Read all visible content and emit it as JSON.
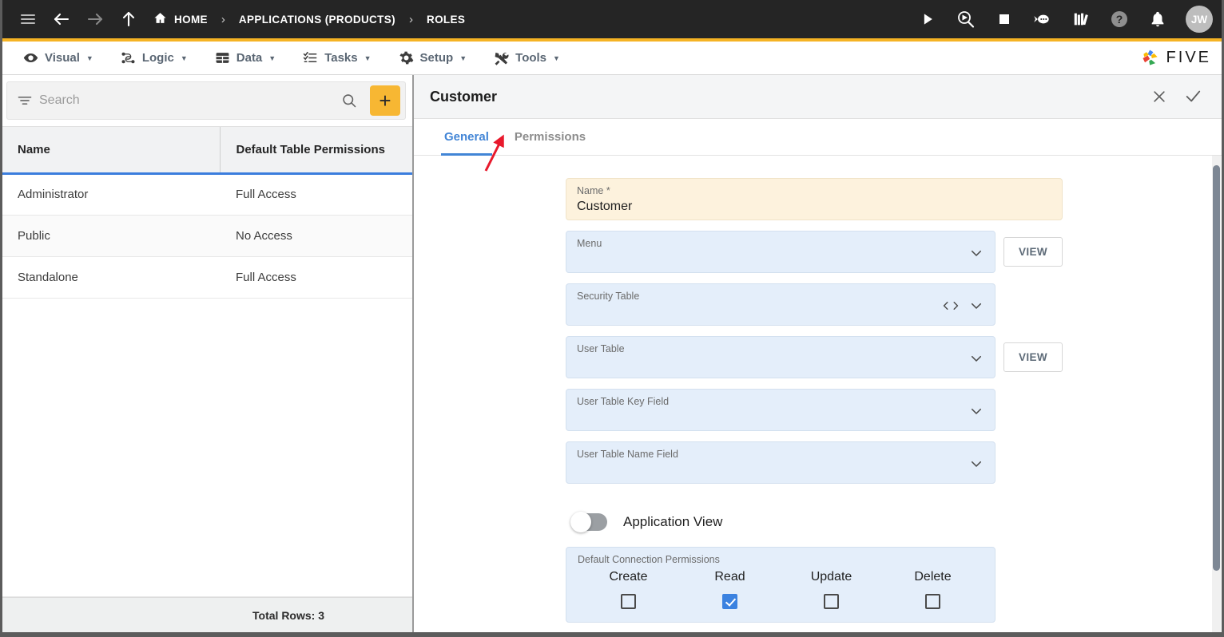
{
  "topbar": {
    "menu_icon": "hamburger-icon",
    "back_icon": "arrow-left-icon",
    "forward_icon": "arrow-right-icon",
    "up_icon": "arrow-up-icon",
    "breadcrumbs": [
      {
        "label": "HOME",
        "icon": "home-icon"
      },
      {
        "label": "APPLICATIONS (PRODUCTS)",
        "icon": ""
      },
      {
        "label": "ROLES",
        "icon": ""
      }
    ],
    "separator": "›",
    "actions": [
      {
        "name": "run-icon",
        "title": "Run"
      },
      {
        "name": "debug-icon",
        "title": "Debug"
      },
      {
        "name": "stop-icon",
        "title": "Stop"
      },
      {
        "name": "chat-bot-icon",
        "title": "Assistant"
      },
      {
        "name": "library-icon",
        "title": "Library"
      },
      {
        "name": "help-icon",
        "title": "Help"
      },
      {
        "name": "notifications-bell-icon",
        "title": "Notifications"
      }
    ],
    "avatar_initials": "JW"
  },
  "menubar": {
    "items": [
      {
        "label": "Visual",
        "icon": "eye-icon",
        "caret": "▼"
      },
      {
        "label": "Logic",
        "icon": "logic-nodes-icon",
        "caret": "▼"
      },
      {
        "label": "Data",
        "icon": "table-grid-icon",
        "caret": "▼"
      },
      {
        "label": "Tasks",
        "icon": "checklist-icon",
        "caret": "▼"
      },
      {
        "label": "Setup",
        "icon": "gear-icon",
        "caret": "▼"
      },
      {
        "label": "Tools",
        "icon": "tools-wrench-icon",
        "caret": "▼"
      }
    ],
    "brand": "FIVE"
  },
  "list_panel": {
    "search": {
      "placeholder": "Search",
      "value": "",
      "filter_icon": "filter-icon",
      "search_icon": "search-icon",
      "add_label": "+"
    },
    "columns": [
      "Name",
      "Default Table Permissions"
    ],
    "rows": [
      {
        "name": "Administrator",
        "permissions": "Full Access"
      },
      {
        "name": "Public",
        "permissions": "No Access"
      },
      {
        "name": "Standalone",
        "permissions": "Full Access"
      }
    ],
    "footer": "Total Rows: 3"
  },
  "detail_panel": {
    "title": "Customer",
    "close_icon": "close-icon",
    "confirm_icon": "check-icon",
    "tabs": [
      {
        "label": "General",
        "active": true
      },
      {
        "label": "Permissions",
        "active": false
      }
    ],
    "fields": [
      {
        "label": "Name *",
        "value": "Customer",
        "style": "name",
        "icons": [],
        "button": ""
      },
      {
        "label": "Menu",
        "value": "",
        "style": "normal",
        "icons": [
          "chevron-down-icon"
        ],
        "button": "VIEW"
      },
      {
        "label": "Security Table",
        "value": "",
        "style": "normal",
        "icons": [
          "code-brackets-icon",
          "chevron-down-icon"
        ],
        "button": ""
      },
      {
        "label": "User Table",
        "value": "",
        "style": "normal",
        "icons": [
          "chevron-down-icon"
        ],
        "button": "VIEW"
      },
      {
        "label": "User Table Key Field",
        "value": "",
        "style": "normal",
        "icons": [
          "chevron-down-icon"
        ],
        "button": ""
      },
      {
        "label": "User Table Name Field",
        "value": "",
        "style": "normal",
        "icons": [
          "chevron-down-icon"
        ],
        "button": ""
      }
    ],
    "toggle": {
      "label": "Application View",
      "on": false
    },
    "permissions": {
      "title": "Default Connection Permissions",
      "items": [
        {
          "label": "Create",
          "checked": false
        },
        {
          "label": "Read",
          "checked": true
        },
        {
          "label": "Update",
          "checked": false
        },
        {
          "label": "Delete",
          "checked": false
        }
      ]
    }
  },
  "colors": {
    "accent_yellow": "#f5b324",
    "topbar_dark": "#252525",
    "tab_blue": "#4285d6",
    "field_blue": "#e4eefa",
    "field_cream": "#fdf2dd",
    "checkbox_blue": "#3b82e0",
    "annotation_red": "#e8192c"
  }
}
